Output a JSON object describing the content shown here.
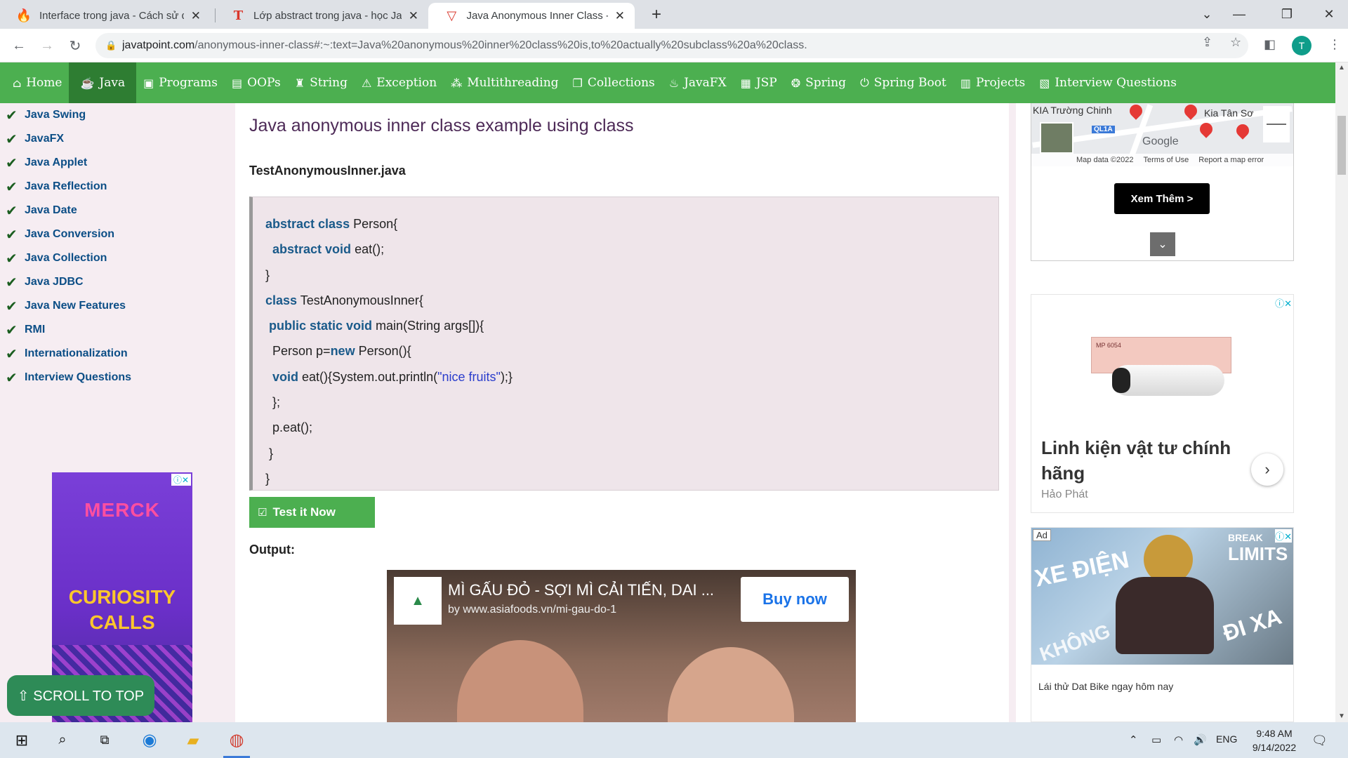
{
  "browser": {
    "tabs": [
      {
        "title": "Interface trong java - Cách sử dụng",
        "favicon": "flame-icon",
        "active": false
      },
      {
        "title": "Lớp abstract trong java - học Java",
        "favicon": "t-icon",
        "active": false
      },
      {
        "title": "Java Anonymous Inner Class - java",
        "favicon": "javatpoint-icon",
        "active": true
      }
    ],
    "new_tab": "+",
    "url_host": "javatpoint.com",
    "url_rest": "/anonymous-inner-class#:~:text=Java%20anonymous%20inner%20class%20is,to%20actually%20subclass%20a%20class.",
    "profile_initial": "T"
  },
  "site_nav": {
    "items": [
      {
        "label": "Home",
        "icon": "home-icon"
      },
      {
        "label": "Java",
        "icon": "java-cup-icon",
        "active": true
      },
      {
        "label": "Programs",
        "icon": "monitor-icon"
      },
      {
        "label": "OOPs",
        "icon": "window-icon"
      },
      {
        "label": "String",
        "icon": "string-icon"
      },
      {
        "label": "Exception",
        "icon": "warning-icon"
      },
      {
        "label": "Multithreading",
        "icon": "threads-icon"
      },
      {
        "label": "Collections",
        "icon": "collections-icon"
      },
      {
        "label": "JavaFX",
        "icon": "javafx-icon"
      },
      {
        "label": "JSP",
        "icon": "jsp-icon"
      },
      {
        "label": "Spring",
        "icon": "spring-icon"
      },
      {
        "label": "Spring Boot",
        "icon": "power-icon"
      },
      {
        "label": "Projects",
        "icon": "projects-icon"
      },
      {
        "label": "Interview Questions",
        "icon": "interview-icon"
      }
    ]
  },
  "sidebar": {
    "items": [
      "Java Swing",
      "JavaFX",
      "Java Applet",
      "Java Reflection",
      "Java Date",
      "Java Conversion",
      "Java Collection",
      "Java JDBC",
      "Java New Features",
      "RMI",
      "Internationalization",
      "Interview Questions"
    ],
    "ad": {
      "brand": "MERCK",
      "tagline_1": "CURIOSITY",
      "tagline_2": "CALLS"
    },
    "scroll_top": "⇧ SCROLL TO TOP"
  },
  "main": {
    "title": "Java anonymous inner class example using class",
    "file_name": "TestAnonymousInner.java",
    "test_button": "Test it Now",
    "output_label": "Output:",
    "video_ad": {
      "title": "MÌ GẤU ĐỎ - SỢI MÌ CẢI TIẾN, DAI ...",
      "source": "by www.asiafoods.vn/mi-gau-do-1",
      "cta": "Buy now"
    }
  },
  "code_lines": [
    [
      {
        "t": "abstract class",
        "k": 1
      },
      {
        "t": " Person{"
      }
    ],
    [
      {
        "t": "  "
      },
      {
        "t": "abstract void",
        "k": 1
      },
      {
        "t": " eat();"
      }
    ],
    [
      {
        "t": "}"
      }
    ],
    [
      {
        "t": "class",
        "k": 1
      },
      {
        "t": " TestAnonymousInner{"
      }
    ],
    [
      {
        "t": " "
      },
      {
        "t": "public static void",
        "k": 1
      },
      {
        "t": " main(String args[]){"
      }
    ],
    [
      {
        "t": "  Person p="
      },
      {
        "t": "new",
        "k": 1
      },
      {
        "t": " Person(){"
      }
    ],
    [
      {
        "t": "  "
      },
      {
        "t": "void",
        "k": 1
      },
      {
        "t": " eat(){System.out.println("
      },
      {
        "t": "\"nice fruits\"",
        "s": 1
      },
      {
        "t": ");}"
      }
    ],
    [
      {
        "t": "  };"
      }
    ],
    [
      {
        "t": "  p.eat();"
      }
    ],
    [
      {
        "t": " }"
      }
    ],
    [
      {
        "t": "}"
      }
    ]
  ],
  "right": {
    "map": {
      "labels": [
        "KIA Trường Chinh",
        "Kia Tân Sơ"
      ],
      "road_label": "QL1A",
      "google": "Google",
      "footer": [
        "Map data ©2022",
        "Terms of Use",
        "Report a map error"
      ]
    },
    "xem_button": "Xem Thêm >",
    "ad1": {
      "title": "Linh kiện vật tư chính hãng",
      "advertiser": "Hảo Phát",
      "product_code": "MP 6054"
    },
    "ad2": {
      "badge": "Ad",
      "headline_1": "XE ĐIỆN",
      "brand": "BREAK",
      "limits": "LIMITS",
      "headline_2": "ĐI XA",
      "headline_3": "KHÔNG",
      "caption": "Lái thử Dat Bike ngay hôm nay"
    }
  },
  "taskbar": {
    "language": "ENG",
    "time": "9:48 AM",
    "date": "9/14/2022"
  }
}
